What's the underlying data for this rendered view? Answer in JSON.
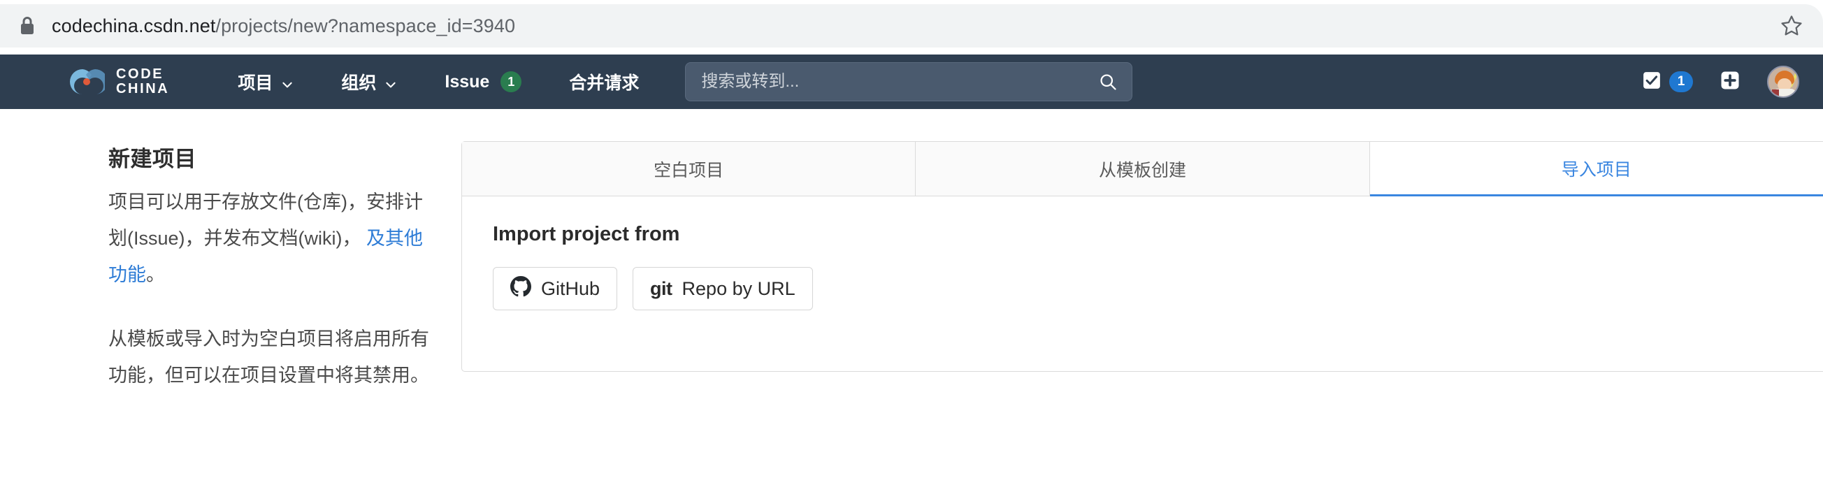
{
  "browser": {
    "url_domain": "codechina.csdn.net",
    "url_path": "/projects/new?namespace_id=3940",
    "lock_icon": "lock-icon",
    "star_icon": "bookmark-star-icon"
  },
  "navbar": {
    "brand": {
      "logo_icon": "codechina-cc-logo-icon",
      "line1": "CODE",
      "line2": "CHINA"
    },
    "items": [
      {
        "label": "项目",
        "has_chevron": true,
        "badge": null
      },
      {
        "label": "组织",
        "has_chevron": true,
        "badge": null
      },
      {
        "label": "Issue",
        "has_chevron": false,
        "badge": "1"
      },
      {
        "label": "合并请求",
        "has_chevron": false,
        "badge": null
      }
    ],
    "search": {
      "placeholder": "搜索或转到...",
      "value": "",
      "icon": "search-icon"
    },
    "right": {
      "todo_icon": "todo-checkbox-icon",
      "todo_count": "1",
      "plus_icon": "plus-icon",
      "avatar_icon": "user-avatar"
    },
    "colors": {
      "background": "#2e3e50",
      "badge_green": "#2a7d4f",
      "badge_blue": "#1f78d1"
    }
  },
  "left": {
    "title": "新建项目",
    "paragraph1_before": "项目可以用于存放文件(仓库)，安排计划(Issue)，并发布文档(wiki)， ",
    "paragraph1_link": "及其他功能",
    "paragraph1_after": "。",
    "paragraph2": "从模板或导入时为空白项目将启用所有功能，但可以在项目设置中将其禁用。",
    "link_color": "#2e7cd6"
  },
  "main": {
    "tabs": [
      {
        "label": "空白项目",
        "active": false
      },
      {
        "label": "从模板创建",
        "active": false
      },
      {
        "label": "导入项目",
        "active": true
      }
    ],
    "active_tab_color": "#3a86e0",
    "import": {
      "heading": "Import project from",
      "buttons": [
        {
          "icon": "github-icon",
          "label": "GitHub"
        },
        {
          "icon": "git-icon",
          "prefix": "git",
          "label": "Repo by URL"
        }
      ]
    }
  }
}
